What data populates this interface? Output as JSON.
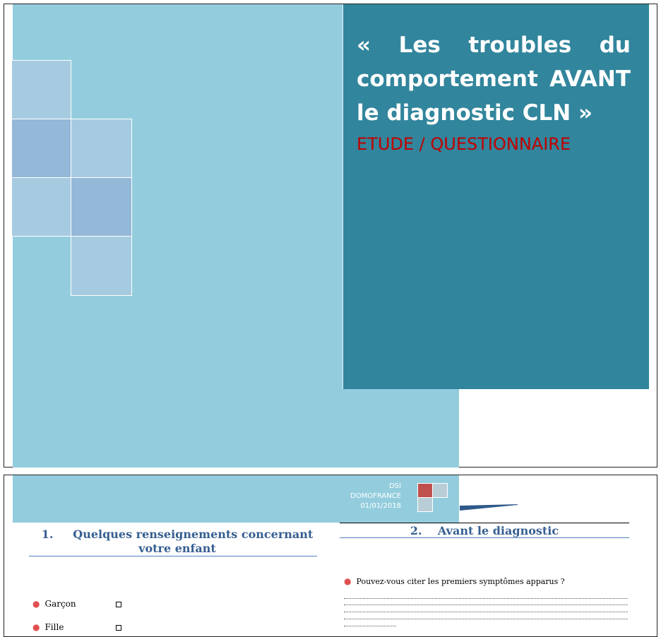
{
  "cover": {
    "title": "« Les troubles du comportement AVANT le diagnostic CLN »",
    "subtitle": "ETUDE / QUESTIONNAIRE",
    "accent_color": "#31859c",
    "band_color": "#93cddd",
    "subtitle_color": "#c00000"
  },
  "header": {
    "line1": "DSI",
    "line2": "DOMOFRANCE",
    "date": "01/01/2018"
  },
  "section1": {
    "number": "1.",
    "title": "Quelques renseignements concernant votre enfant",
    "items": [
      {
        "label": "Garçon",
        "checkbox": "☐"
      },
      {
        "label": "Fille",
        "checkbox": "☐"
      }
    ]
  },
  "section2": {
    "number": "2.",
    "title": "Avant le diagnostic",
    "question": "Pouvez-vous citer les premiers symptômes apparus ?"
  }
}
